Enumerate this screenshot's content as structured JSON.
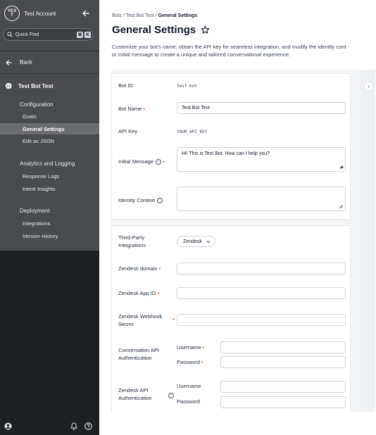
{
  "sidebar": {
    "logo_text": "YEXT",
    "account_name": "Test Account",
    "quick_find_label": "Quick Find",
    "quick_find_keys": [
      "⌘",
      "K"
    ],
    "back_label": "Back",
    "bot_name": "Test Bot Test",
    "sections": [
      {
        "heading": "Configuration",
        "items": [
          "Goals",
          "General Settings",
          "Edit as JSON"
        ]
      },
      {
        "heading": "Analytics and Logging",
        "items": [
          "Response Logs",
          "Intent Insights"
        ]
      },
      {
        "heading": "Deployment",
        "items": [
          "Integrations",
          "Version History"
        ]
      }
    ],
    "active_item": "General Settings"
  },
  "header": {
    "breadcrumb": [
      "Bots",
      "Test Bot Test",
      "General Settings"
    ],
    "title": "General Settings",
    "description_line1": "Customize your bot's name, obtain the API key for seamless integration, and modify the identity cont",
    "description_line2": "or initial message to create a unique and tailored conversational experience."
  },
  "form": {
    "bot_id_label": "Bot ID",
    "bot_id_value": "test-bot",
    "bot_name_label": "Bot Name",
    "bot_name_value": "Test Bot Test",
    "api_key_label": "API Key",
    "api_key_value": "YOUR_API_KEY",
    "initial_message_label": "Initial Message",
    "initial_message_value": "Hi! This is Test Bot. How can I help you?",
    "identity_context_label": "Identity Context",
    "identity_context_value": "",
    "third_party_label_1": "Third-Party",
    "third_party_label_2": "Integrations",
    "third_party_value": "Zendesk",
    "zendesk_domain_label": "Zendesk domain",
    "zendesk_app_id_label": "Zendesk App ID",
    "zendesk_webhook_label_1": "Zendesk Webhook",
    "zendesk_webhook_label_2": "Secret",
    "conv_api_label_1": "Conversation API",
    "conv_api_label_2": "Authentication",
    "zendesk_api_label_1": "Zendesk API",
    "zendesk_api_label_2": "Authentication",
    "username_label": "Username",
    "password_label": "Password",
    "required_marker": "•",
    "info_glyph": "i"
  }
}
